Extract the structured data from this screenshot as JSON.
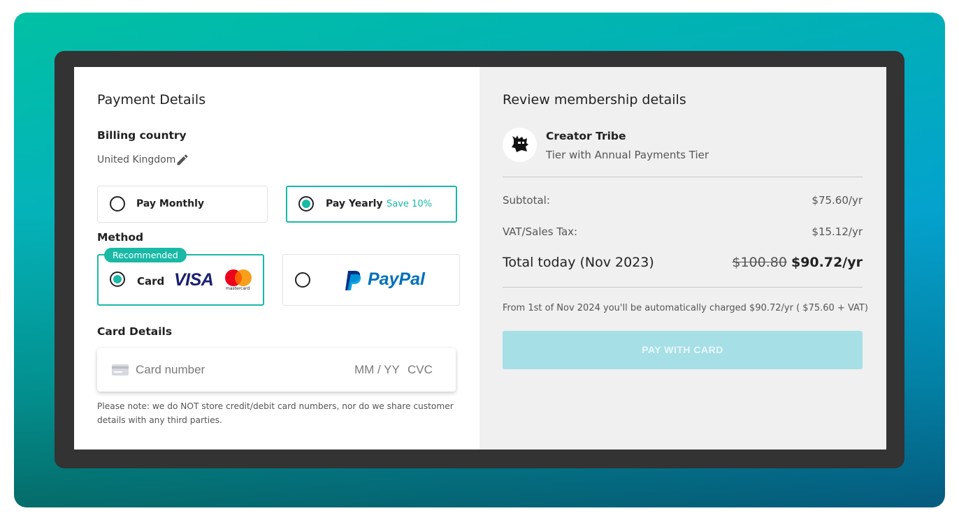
{
  "payment": {
    "title": "Payment Details",
    "billing_label": "Billing country",
    "country": "United Kingdom",
    "plans": [
      {
        "label": "Pay Monthly",
        "selected": false
      },
      {
        "label": "Pay Yearly",
        "note": "Save 10%",
        "selected": true
      }
    ],
    "method_label": "Method",
    "recommended": "Recommended",
    "card_label": "Card",
    "visa": "VISA",
    "mastercard": "mastercard",
    "paypal": "PayPal",
    "card_details_label": "Card Details",
    "card_number_placeholder": "Card number",
    "expiry_placeholder": "MM / YY",
    "cvc_placeholder": "CVC",
    "note": "Please note: we do NOT store credit/debit card numbers, nor do we share customer details with any third parties."
  },
  "review": {
    "title": "Review membership details",
    "creator": "Creator Tribe",
    "tier": "Tier with Annual Payments Tier",
    "subtotal_label": "Subtotal:",
    "subtotal_value": "$75.60/yr",
    "vat_label": "VAT/Sales Tax:",
    "vat_value": "$15.12/yr",
    "total_label": "Total today (Nov 2023)",
    "old_price": "$100.80",
    "total_value": "$90.72/yr",
    "renewal_note": "From 1st of Nov 2024 you'll be automatically charged $90.72/yr ( $75.60 + VAT)",
    "pay_button": "PAY WITH CARD"
  },
  "colors": {
    "accent": "#19b9a6",
    "button_disabled": "#a6dfe6"
  }
}
